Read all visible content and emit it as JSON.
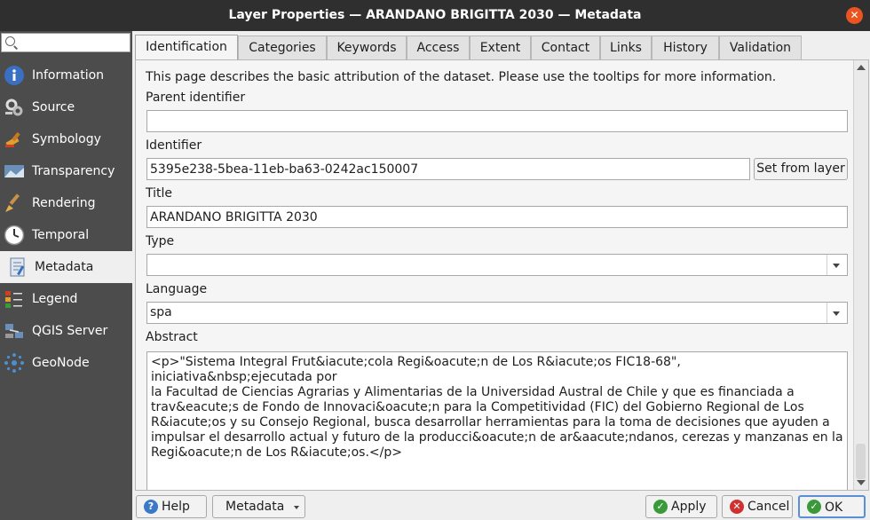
{
  "window": {
    "title": "Layer Properties — ARANDANO BRIGITTA 2030 — Metadata"
  },
  "sidebar": {
    "search_placeholder": "",
    "items": [
      {
        "label": "Information",
        "icon": "information-icon"
      },
      {
        "label": "Source",
        "icon": "source-icon"
      },
      {
        "label": "Symbology",
        "icon": "symbology-icon"
      },
      {
        "label": "Transparency",
        "icon": "transparency-icon"
      },
      {
        "label": "Rendering",
        "icon": "rendering-icon"
      },
      {
        "label": "Temporal",
        "icon": "temporal-icon"
      },
      {
        "label": "Metadata",
        "icon": "metadata-icon",
        "selected": true
      },
      {
        "label": "Legend",
        "icon": "legend-icon"
      },
      {
        "label": "QGIS Server",
        "icon": "qgis-server-icon"
      },
      {
        "label": "GeoNode",
        "icon": "geonode-icon"
      }
    ]
  },
  "tabs": [
    "Identification",
    "Categories",
    "Keywords",
    "Access",
    "Extent",
    "Contact",
    "Links",
    "History",
    "Validation"
  ],
  "active_tab": "Identification",
  "identification": {
    "intro": "This page describes the basic attribution of the dataset. Please use the tooltips for more information.",
    "parent_identifier_label": "Parent identifier",
    "parent_identifier_value": "",
    "identifier_label": "Identifier",
    "identifier_value": "5395e238-5bea-11eb-ba63-0242ac150007",
    "set_from_layer": "Set from layer",
    "title_label": "Title",
    "title_value": "ARANDANO BRIGITTA 2030",
    "type_label": "Type",
    "type_value": "",
    "language_label": "Language",
    "language_value": "spa",
    "abstract_label": "Abstract",
    "abstract_value": "<p>\"Sistema Integral Frut&iacute;cola Regi&oacute;n de Los R&iacute;os FIC18-68\", iniciativa&nbsp;ejecutada por\nla Facultad de Ciencias Agrarias y Alimentarias de la Universidad Austral de Chile y que es financiada a\ntrav&eacute;s de Fondo de Innovaci&oacute;n para la Competitividad (FIC) del Gobierno Regional de Los\nR&iacute;os y su Consejo Regional, busca desarrollar herramientas para la toma de decisiones que ayuden a\nimpulsar el desarrollo actual y futuro de la producci&oacute;n de ar&aacute;ndanos, cerezas y manzanas en la\nRegi&oacute;n de Los R&iacute;os.</p>"
  },
  "buttons": {
    "help": "Help",
    "metadata": "Metadata",
    "apply": "Apply",
    "cancel": "Cancel",
    "ok": "OK"
  },
  "colors": {
    "accent_close": "#e95420",
    "apply": "#3a9a3a",
    "cancel": "#d03030",
    "help": "#3a78c8"
  }
}
